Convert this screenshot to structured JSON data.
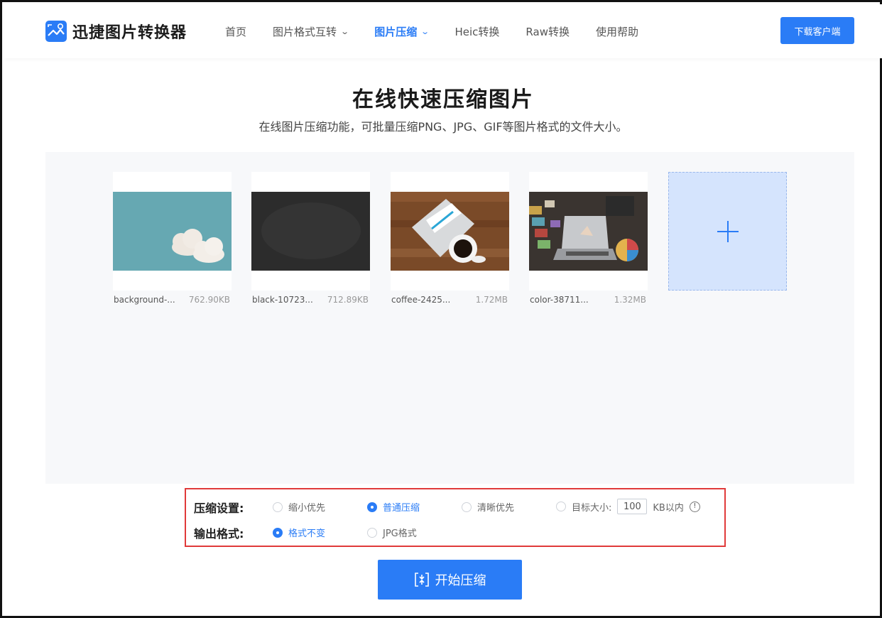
{
  "header": {
    "brand": "迅捷图片转换器",
    "nav": [
      {
        "label": "首页",
        "dropdown": false,
        "active": false
      },
      {
        "label": "图片格式互转",
        "dropdown": true,
        "active": false
      },
      {
        "label": "图片压缩",
        "dropdown": true,
        "active": true
      },
      {
        "label": "Heic转换",
        "dropdown": false,
        "active": false
      },
      {
        "label": "Raw转换",
        "dropdown": false,
        "active": false
      },
      {
        "label": "使用帮助",
        "dropdown": false,
        "active": false
      }
    ],
    "download_label": "下载客户端"
  },
  "hero": {
    "title": "在线快速压缩图片",
    "subtitle": "在线图片压缩功能，可批量压缩PNG、JPG、GIF等图片格式的文件大小。"
  },
  "files": [
    {
      "name": "background-...",
      "size": "762.90KB",
      "thumb": "teal-clouds"
    },
    {
      "name": "black-10723...",
      "size": "712.89KB",
      "thumb": "chalkboard"
    },
    {
      "name": "coffee-2425...",
      "size": "1.72MB",
      "thumb": "coffee-desk"
    },
    {
      "name": "color-38711...",
      "size": "1.32MB",
      "thumb": "laptop-swatches"
    }
  ],
  "add_icon": "plus-icon",
  "settings": {
    "compress_label": "压缩设置:",
    "compress_options": [
      {
        "label": "缩小优先",
        "selected": false
      },
      {
        "label": "普通压缩",
        "selected": true
      },
      {
        "label": "清晰优先",
        "selected": false
      },
      {
        "label": "目标大小:",
        "selected": false
      }
    ],
    "target_value": "100",
    "target_unit": "KB以内",
    "format_label": "输出格式:",
    "format_options": [
      {
        "label": "格式不变",
        "selected": true
      },
      {
        "label": "JPG格式",
        "selected": false
      }
    ]
  },
  "start_label": "开始压缩",
  "colors": {
    "accent": "#2a7cf6",
    "highlight_border": "#e03a3a"
  }
}
